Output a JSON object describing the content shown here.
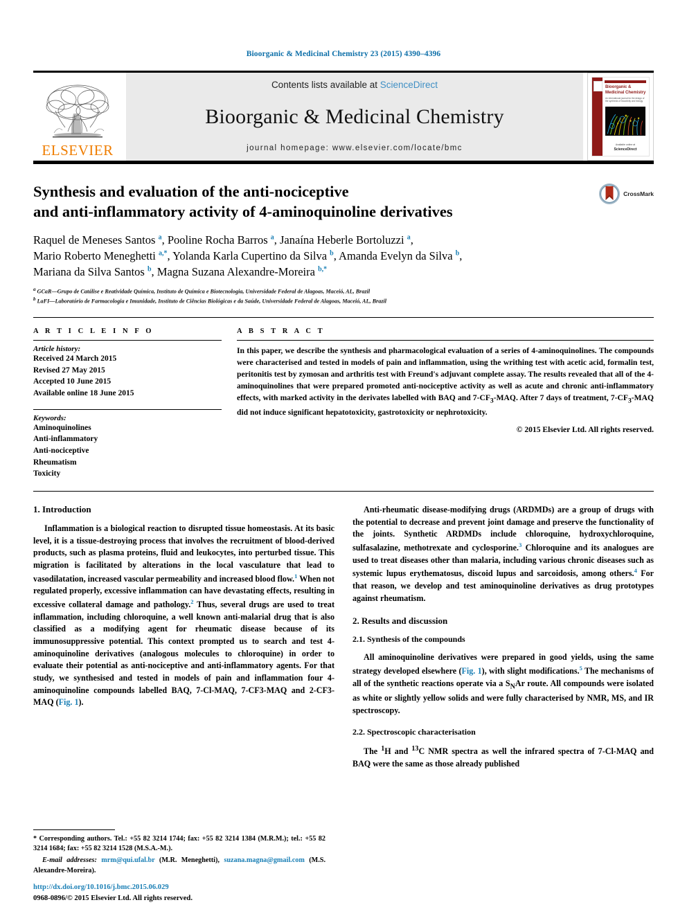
{
  "running_head": "Bioorganic & Medicinal Chemistry 23 (2015) 4390–4396",
  "masthead": {
    "publisher_logo_text": "ELSEVIER",
    "contents_prefix": "Contents lists available at ",
    "contents_link": "ScienceDirect",
    "journal_title": "Bioorganic & Medicinal Chemistry",
    "homepage": "journal homepage: www.elsevier.com/locate/bmc",
    "cover": {
      "title": "Bioorganic & Medicinal Chemistry",
      "subtitle": "An international journal for the design of the synthesis of bioactivity and biology",
      "footer_small": "Available online at",
      "footer_brand": "ScienceDirect"
    }
  },
  "crossmark": {
    "label": "CrossMark"
  },
  "article": {
    "title_line1": "Synthesis and evaluation of the anti-nociceptive",
    "title_line2": "and anti-inflammatory activity of 4-aminoquinoline derivatives",
    "authors_line1": "Raquel de Meneses Santos <sup>a</sup>, Pooline Rocha Barros <sup>a</sup>, Janaína Heberle Bortoluzzi <sup>a</sup>,",
    "authors_line2": "Mario Roberto Meneghetti <sup>a,*</sup>, Yolanda Karla Cupertino da Silva <sup>b</sup>, Amanda Evelyn da Silva <sup>b</sup>,",
    "authors_line3": "Mariana da Silva Santos <sup>b</sup>, Magna Suzana Alexandre-Moreira <sup>b,*</sup>",
    "affiliation_a": "<sup>a</sup> GCaR—Grupo de Catálise e Reatividade Química, Instituto de Química e Biotecnologia, Universidade Federal de Alagoas, Maceió, AL, Brazil",
    "affiliation_b": "<sup>b</sup> LaFI—Laboratório de Farmacologia e Imunidade, Instituto de Ciências Biológicas e da Saúde, Universidade Federal de Alagoas, Maceió, AL, Brazil"
  },
  "article_info": {
    "heading": "A R T I C L E   I N F O",
    "history_label": "Article history:",
    "history": [
      "Received 24 March 2015",
      "Revised 27 May 2015",
      "Accepted 10 June 2015",
      "Available online 18 June 2015"
    ],
    "keywords_label": "Keywords:",
    "keywords": [
      "Aminoquinolines",
      "Anti-inflammatory",
      "Anti-nociceptive",
      "Rheumatism",
      "Toxicity"
    ]
  },
  "abstract": {
    "heading": "A B S T R A C T",
    "text_html": "In this paper, we describe the synthesis and pharmacological evaluation of a series of 4-aminoquinolines. The compounds were characterised and tested in models of pain and inflammation, using the writhing test with acetic acid, formalin test, peritonitis test by zymosan and arthritis test with Freund's adjuvant complete assay. The results revealed that all of the 4-aminoquinolines that were prepared promoted anti-nociceptive activity as well as acute and chronic anti-inflammatory effects, with marked activity in the derivates labelled with <b>BAQ</b> and <b>7-CF<sub>3</sub>-MAQ</b>. After 7 days of treatment, <b>7-CF<sub>3</sub>-MAQ</b> did not induce significant hepatotoxicity, gastrotoxicity or nephrotoxicity.",
    "copyright": "© 2015 Elsevier Ltd. All rights reserved."
  },
  "body": {
    "left": {
      "section1_heading": "1. Introduction",
      "para1_html": "Inflammation is a biological reaction to disrupted tissue homeostasis. At its basic level, it is a tissue-destroying process that involves the recruitment of blood-derived products, such as plasma proteins, fluid and leukocytes, into perturbed tissue. This migration is facilitated by alterations in the local vasculature that lead to vasodilatation, increased vascular permeability and increased blood flow.<span class=\"ref\">1</span> When not regulated properly, excessive inflammation can have devastating effects, resulting in excessive collateral damage and pathology.<span class=\"ref\">2</span> Thus, several drugs are used to treat inflammation, including chloroquine, a well known anti-malarial drug that is also classified as a modifying agent for rheumatic disease because of its immunosuppressive potential. This context prompted us to search and test 4-aminoquinoline derivatives (analogous molecules to chloroquine) in order to evaluate their potential as anti-nociceptive and anti-inflammatory agents. For that study, we synthesised and tested in models of pain and inflammation four 4-aminoquinoline compounds labelled <b>BAQ, 7-Cl-MAQ, 7-CF3-MAQ</b> and <b>2-CF3-MAQ</b> (<span class=\"xlink\">Fig. 1</span>)."
    },
    "right": {
      "para1_html": "Anti-rheumatic disease-modifying drugs (ARDMDs) are a group of drugs with the potential to decrease and prevent joint damage and preserve the functionality of the joints. Synthetic ARDMDs include chloroquine, hydroxychloroquine, sulfasalazine, methotrexate and cyclosporine.<span class=\"ref\">3</span> Chloroquine and its analogues are used to treat diseases other than malaria, including various chronic diseases such as systemic lupus erythematosus, discoid lupus and sarcoidosis, among others.<span class=\"ref\">4</span> For that reason, we develop and test aminoquinoline derivatives as drug prototypes against rheumatism.",
      "section2_heading": "2. Results and discussion",
      "section21_heading": "2.1. Synthesis of the compounds",
      "para2_html": "All aminoquinoline derivatives were prepared in good yields, using the same strategy developed elsewhere (<span class=\"xlink\">Fig. 1</span>), with slight modifications.<span class=\"ref\">5</span> The mechanisms of all of the synthetic reactions operate via a S<sub>N</sub>Ar route. All compounds were isolated as white or slightly yellow solids and were fully characterised by NMR, MS, and IR spectroscopy.",
      "section22_heading": "2.2. Spectroscopic characterisation",
      "para3_html": "The <sup>1</sup>H and <sup>13</sup>C NMR spectra as well the infrared spectra of <b>7-Cl-MAQ</b> and <b>BAQ</b> were the same as those already published"
    }
  },
  "footnotes": {
    "corresponding_html": "* Corresponding authors. Tel.: +55 82 3214 1744; fax: +55 82 3214 1384 (M.R.M.); tel.: +55 82 3214 1684; fax: +55 82 3214 1528 (M.S.A.-M.).",
    "email_label": "E-mail addresses:",
    "email1": "mrm@qui.ufal.br",
    "email1_owner": "(M.R. Meneghetti),",
    "email2": "suzana.magna@gmail.com",
    "email2_owner": "(M.S. Alexandre-Moreira)."
  },
  "doi_block": {
    "doi_url": "http://dx.doi.org/10.1016/j.bmc.2015.06.029",
    "issn_line": "0968-0896/© 2015 Elsevier Ltd. All rights reserved."
  },
  "colors": {
    "link_blue": "#1a7fb5",
    "header_blue": "#0b6ea8",
    "elsevier_orange": "#ef7d00",
    "band_gray": "#eaeaea",
    "cover_red": "#8e1a18"
  }
}
